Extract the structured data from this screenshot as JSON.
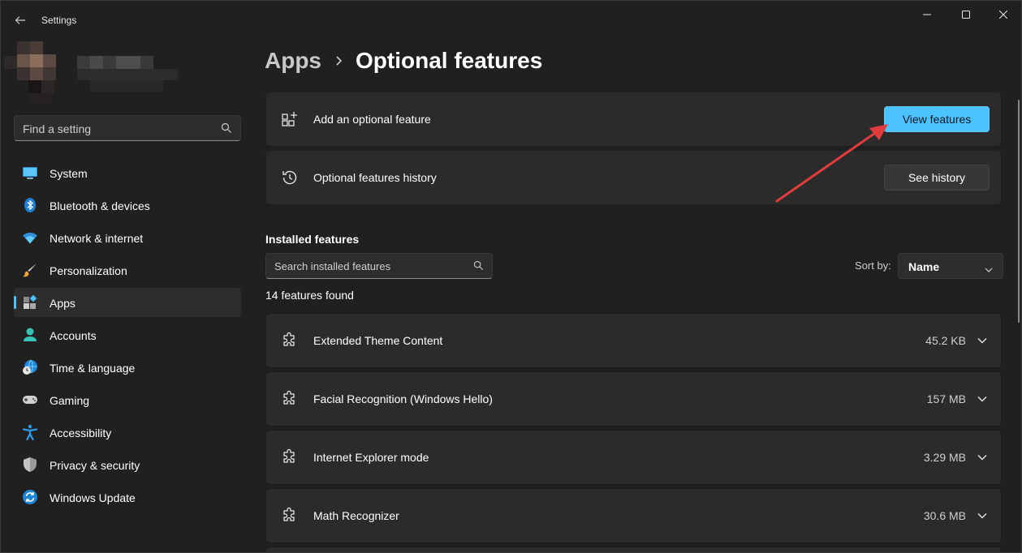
{
  "window": {
    "title": "Settings"
  },
  "search": {
    "placeholder": "Find a setting"
  },
  "nav": {
    "items": [
      {
        "label": "System",
        "icon": "monitor-icon"
      },
      {
        "label": "Bluetooth & devices",
        "icon": "bluetooth-icon"
      },
      {
        "label": "Network & internet",
        "icon": "wifi-icon"
      },
      {
        "label": "Personalization",
        "icon": "brush-icon"
      },
      {
        "label": "Apps",
        "icon": "apps-icon",
        "active": true
      },
      {
        "label": "Accounts",
        "icon": "person-icon"
      },
      {
        "label": "Time & language",
        "icon": "globe-clock-icon"
      },
      {
        "label": "Gaming",
        "icon": "gamepad-icon"
      },
      {
        "label": "Accessibility",
        "icon": "accessibility-icon"
      },
      {
        "label": "Privacy & security",
        "icon": "shield-icon"
      },
      {
        "label": "Windows Update",
        "icon": "update-icon"
      }
    ]
  },
  "breadcrumb": {
    "parent": "Apps",
    "current": "Optional features"
  },
  "add_feature": {
    "label": "Add an optional feature",
    "button": "View features"
  },
  "history": {
    "label": "Optional features history",
    "button": "See history"
  },
  "installed": {
    "title": "Installed features",
    "search_placeholder": "Search installed features",
    "sort_label": "Sort by:",
    "sort_value": "Name",
    "count": "14 features found",
    "features": [
      {
        "name": "Extended Theme Content",
        "size": "45.2 KB"
      },
      {
        "name": "Facial Recognition (Windows Hello)",
        "size": "157 MB"
      },
      {
        "name": "Internet Explorer mode",
        "size": "3.29 MB"
      },
      {
        "name": "Math Recognizer",
        "size": "30.6 MB"
      }
    ]
  },
  "colors": {
    "accent": "#4cc2ff",
    "annotation_arrow": "#e03c3c",
    "background": "#202020",
    "card": "#2b2b2b"
  }
}
